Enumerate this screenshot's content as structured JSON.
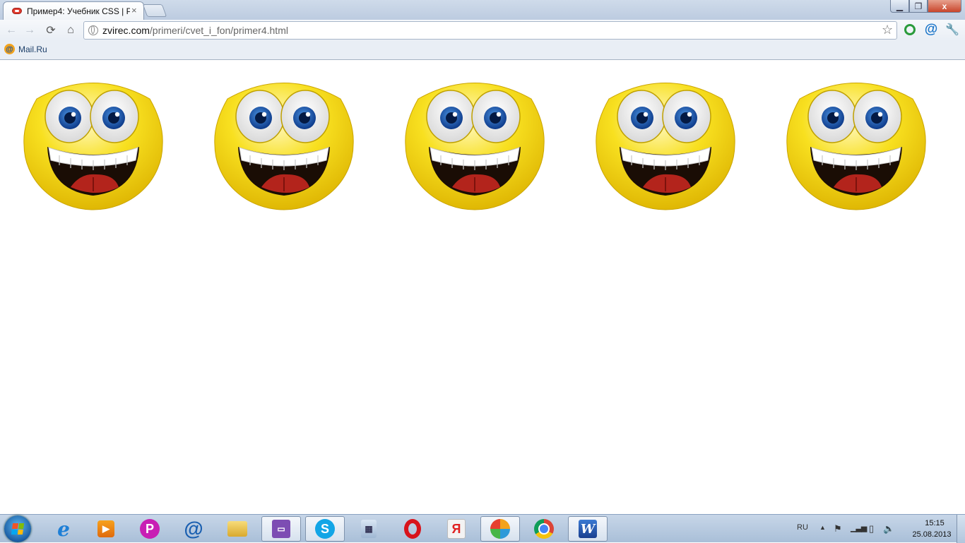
{
  "browser": {
    "tab_title": "Пример4: Учебник CSS | Р",
    "tab_close_icon": "close-icon",
    "url_domain": "zvirec.com",
    "url_path": "/primeri/cvet_i_fon/primer4.html",
    "window_close": "x",
    "bookmark_label": "Mail.Ru"
  },
  "page": {
    "smiley_count": 5
  },
  "taskbar": {
    "language": "RU",
    "time": "15:15",
    "date": "25.08.2013"
  },
  "colors": {
    "smiley_yellow": "#f5d50a",
    "iris_blue": "#1550a8",
    "tongue_red": "#b3241c",
    "taskbar": "#b5c8de"
  }
}
